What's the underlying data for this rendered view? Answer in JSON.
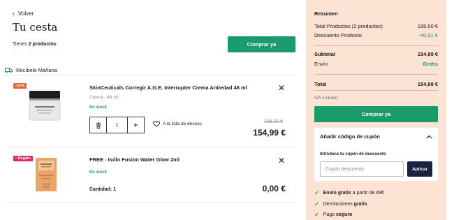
{
  "header": {
    "back_label": "Volver",
    "title": "Tu cesta",
    "count_prefix": "Tienes",
    "count_value": "2 productos",
    "buy_label": "Comprar ya"
  },
  "delivery": {
    "label": "Recíbelo Mañana"
  },
  "items": [
    {
      "badge": "-21%",
      "badge_color": "#e8643c",
      "name": "SkinCeuticals Corregir A.G.E. Interrupter Crema Antiedad 48 ml",
      "volume": "Crema - 48 ml",
      "stock": "En stock",
      "quantity": "1",
      "wishlist": "A la lista de deseos",
      "old_price": "195,00 €",
      "price": "154,99 €"
    },
    {
      "badge": "Regalo",
      "badge_color": "#e0245e",
      "name": "FREE - Isdin Fusion Water Glow 2ml",
      "stock": "En stock",
      "quantity_text": "Cantidad: 1",
      "price": "0,00 €"
    }
  ],
  "summary": {
    "title": "Resumen",
    "rows": [
      {
        "label": "Total Productos (2 productos)",
        "value": "195,00 €"
      },
      {
        "label": "Descuento Producto",
        "value": "-40,01 €"
      },
      {
        "label": "Subtotal",
        "value": "154,99 €"
      },
      {
        "label": "Envío",
        "value": "Gratis"
      },
      {
        "label": "Total",
        "value": "154,99 €"
      }
    ],
    "iva": "IVA incluido",
    "buy_label": "Comprar ya",
    "coupon": {
      "title": "Añadir código de cupón",
      "label": "Introduce tu cupón de descuento",
      "placeholder": "Cupón descuento",
      "apply_label": "Aplicar"
    },
    "benefits": [
      {
        "bold": "Envío gratis",
        "rest": " a partir de 49€"
      },
      {
        "pre": "Devoluciones ",
        "bold": "gratis"
      },
      {
        "pre": "Pago ",
        "bold": "seguro"
      }
    ]
  },
  "colors": {
    "accent": "#1a9b6c",
    "panel": "#fde3d4",
    "apply": "#1c2340"
  }
}
